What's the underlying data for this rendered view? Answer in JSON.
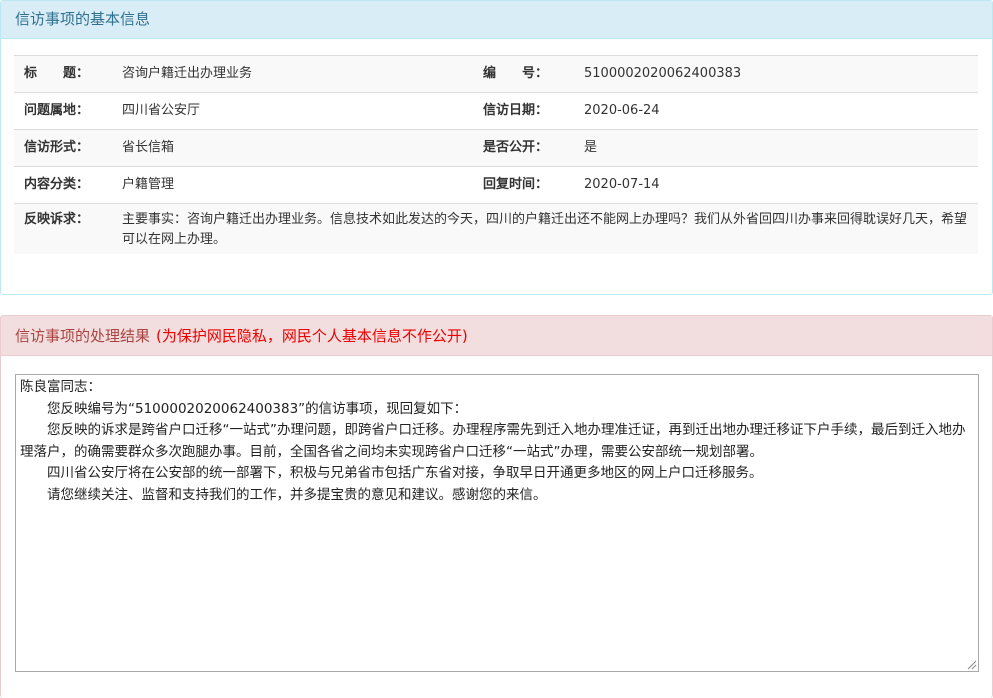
{
  "basic": {
    "header": "信访事项的基本信息",
    "rows": [
      {
        "l1": "标　　题：",
        "v1": "咨询户籍迁出办理业务",
        "l2": "编　　号：",
        "v2": "5100002020062400383"
      },
      {
        "l1": "问题属地：",
        "v1": "四川省公安厅",
        "l2": "信访日期：",
        "v2": "2020-06-24"
      },
      {
        "l1": "信访形式：",
        "v1": "省长信箱",
        "l2": "是否公开：",
        "v2": "是"
      },
      {
        "l1": "内容分类：",
        "v1": "户籍管理",
        "l2": "回复时间：",
        "v2": "2020-07-14"
      }
    ],
    "complaint_label": "反映诉求：",
    "complaint_text": "主要事实：咨询户籍迁出办理业务。信息技术如此发达的今天，四川的户籍迁出还不能网上办理吗？我们从外省回四川办事来回得耽误好几天，希望可以在网上办理。"
  },
  "result": {
    "header": "信访事项的处理结果",
    "privacy_note": "(为保护网民隐私，网民个人基本信息不作公开)",
    "reply_lines": [
      "陈良富同志：",
      "您反映编号为“5100002020062400383”的信访事项，现回复如下：",
      "您反映的诉求是跨省户口迁移“一站式”办理问题，即跨省户口迁移。办理程序需先到迁入地办理准迁证，再到迁出地办理迁移证下户手续，最后到迁入地办理落户，的确需要群众多次跑腿办事。目前，全国各省之间均未实现跨省户口迁移“一站式”办理，需要公安部统一规划部署。",
      "四川省公安厅将在公安部的统一部署下，积极与兄弟省市包括广东省对接，争取早日开通更多地区的网上户口迁移服务。",
      "请您继续关注、监督和支持我们的工作，并多提宝贵的意见和建议。感谢您的来信。"
    ]
  }
}
